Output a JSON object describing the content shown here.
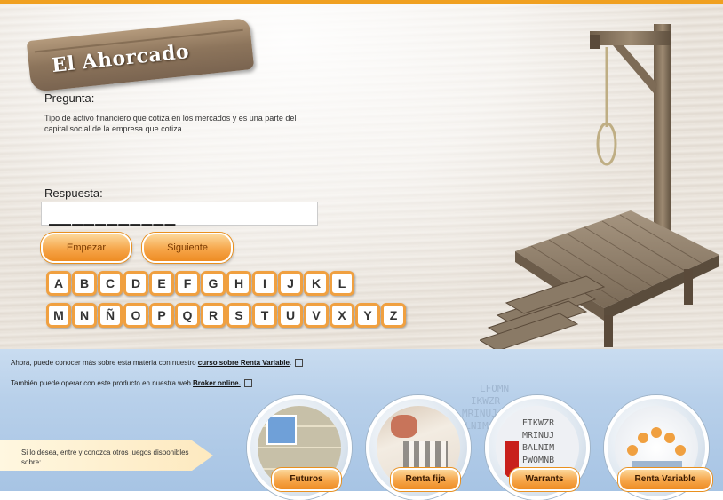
{
  "game": {
    "title": "El Ahorcado",
    "question_label": "Pregunta:",
    "question_text": "Tipo de activo financiero que cotiza en los mercados y es una parte del capital social de la empresa que cotiza",
    "answer_label": "Respuesta:",
    "answer_value": "___________",
    "buttons": {
      "start": "Empezar",
      "next": "Siguiente"
    },
    "letters_row1": [
      "A",
      "B",
      "C",
      "D",
      "E",
      "F",
      "G",
      "H",
      "I",
      "J",
      "K",
      "L"
    ],
    "letters_row2": [
      "M",
      "N",
      "Ñ",
      "O",
      "P",
      "Q",
      "R",
      "S",
      "T",
      "U",
      "V",
      "X",
      "Y",
      "Z"
    ]
  },
  "info": {
    "line1_prefix": "Ahora, puede conocer más sobre esta materia con nuestro ",
    "line1_link": "curso sobre Renta Variable",
    "line1_suffix": ".",
    "line2_prefix": "También puede operar con este producto en nuestra web ",
    "line2_link": "Broker online.",
    "promo_text": "Si lo desea, entre y conozca otros juegos disponibles sobre:"
  },
  "games_links": [
    "Futuros",
    "Renta fija",
    "Warrants",
    "Renta Variable"
  ],
  "colors": {
    "accent": "#f6a64a",
    "border": "#f0a040",
    "panel": "#b8d0ea"
  }
}
